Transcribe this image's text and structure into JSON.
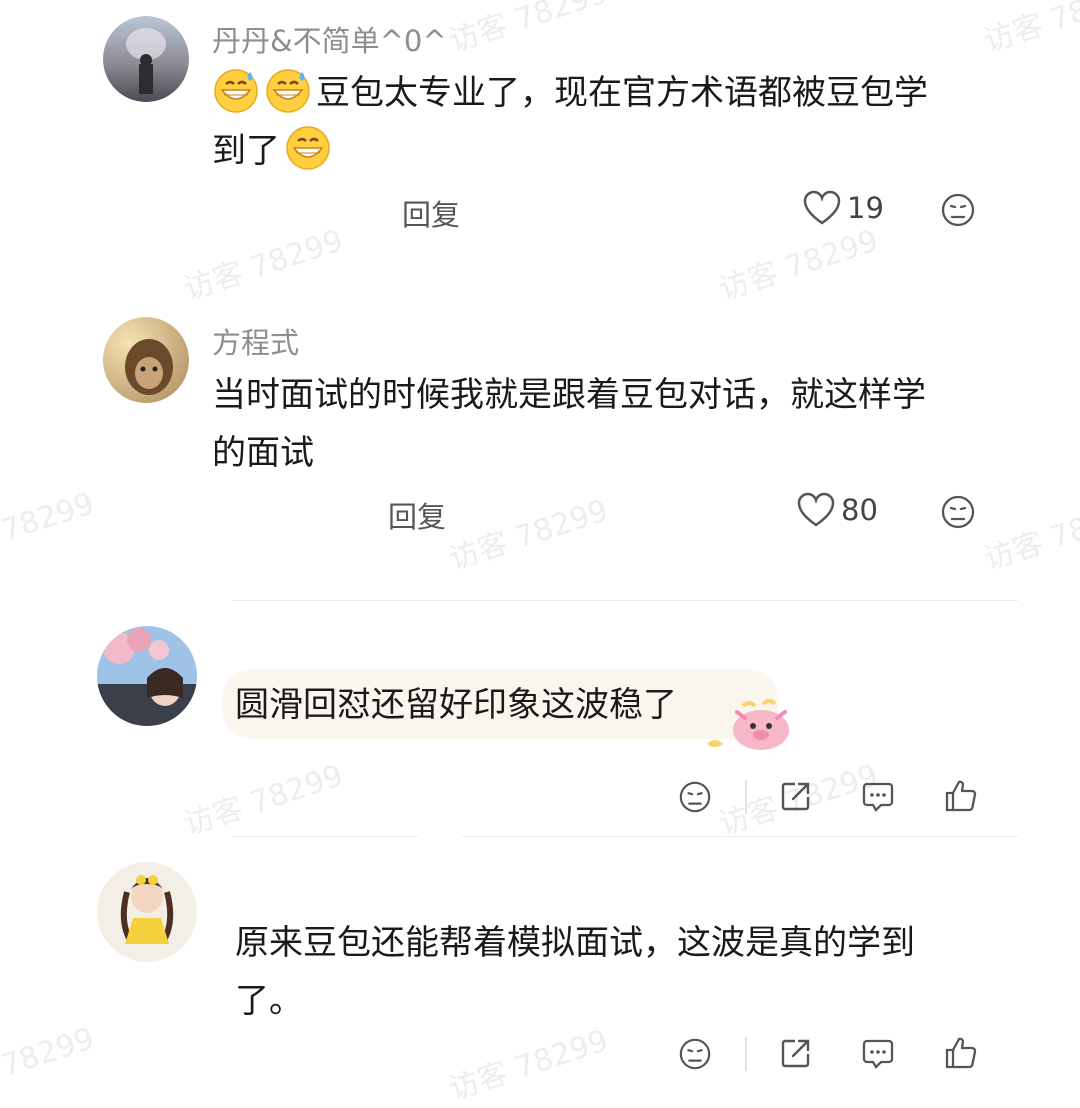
{
  "comments": [
    {
      "username": "丹丹&不简单^0^",
      "text_line1": "豆包太专业了，现在官方术语都被豆包学",
      "text_line2": "到了",
      "reply_label": "回复",
      "likes": "19"
    },
    {
      "username": "方程式",
      "text_line1": "当时面试的时候我就是跟着豆包对话，就这样学",
      "text_line2": "的面试",
      "reply_label": "回复",
      "likes": "80"
    },
    {
      "text": "圆滑回怼还留好印象这波稳了"
    },
    {
      "text_line1": "原来豆包还能帮着模拟面试，这波是真的学到",
      "text_line2": "了。"
    }
  ],
  "watermark": "访客 78299",
  "watermark_partial": "78299",
  "colors": {
    "text": "#1a1a1a",
    "username": "#8e8e8e",
    "icon": "#555555",
    "bubble": "#faf6ee"
  },
  "icons": [
    "grinning-sweat-emoji",
    "grin-emoji",
    "heart-icon",
    "dislike-face-icon",
    "share-icon",
    "comment-icon",
    "thumbs-up-icon",
    "sticker-pig"
  ]
}
